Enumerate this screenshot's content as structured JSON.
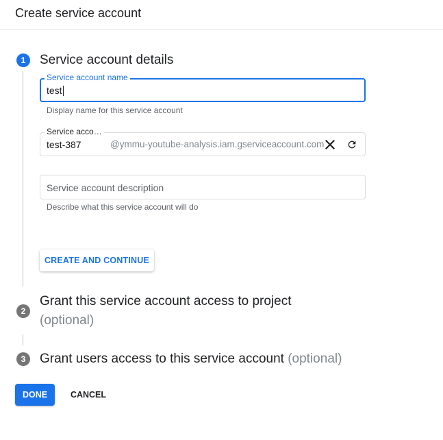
{
  "header": {
    "title": "Create service account"
  },
  "steps": [
    {
      "number": "1",
      "title": "Service account details",
      "optional": ""
    },
    {
      "number": "2",
      "title": "Grant this service account access to project",
      "optional": "(optional)"
    },
    {
      "number": "3",
      "title": "Grant users access to this service account",
      "optional": "(optional)"
    }
  ],
  "form": {
    "name": {
      "label": "Service account name",
      "value": "test",
      "hint": "Display name for this service account"
    },
    "id": {
      "label": "Service acco…",
      "value": "test-387",
      "suffix": "@ymmu-youtube-analysis.iam.gserviceaccount.com"
    },
    "description": {
      "placeholder": "Service account description",
      "hint": "Describe what this service account will do"
    }
  },
  "buttons": {
    "create_continue": "CREATE AND CONTINUE",
    "done": "DONE",
    "cancel": "CANCEL"
  },
  "colors": {
    "accent": "#1a73e8",
    "inactive_step": "#757575"
  }
}
